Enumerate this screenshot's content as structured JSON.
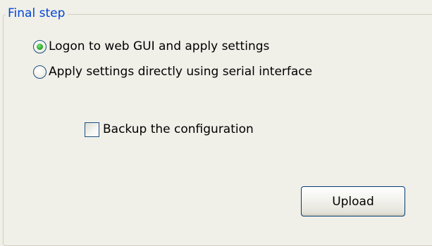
{
  "group": {
    "title": "Final step"
  },
  "options": {
    "radio_1": {
      "label": "Logon to web GUI and apply settings",
      "checked": true
    },
    "radio_2": {
      "label": "Apply settings directly using serial interface",
      "checked": false
    }
  },
  "backup": {
    "label": "Backup the configuration",
    "checked": false
  },
  "actions": {
    "upload_label": "Upload"
  },
  "colors": {
    "title": "#0046d5",
    "background": "#f0efe8",
    "control_border": "#1c5180",
    "radio_dot": "#2fae2f"
  }
}
